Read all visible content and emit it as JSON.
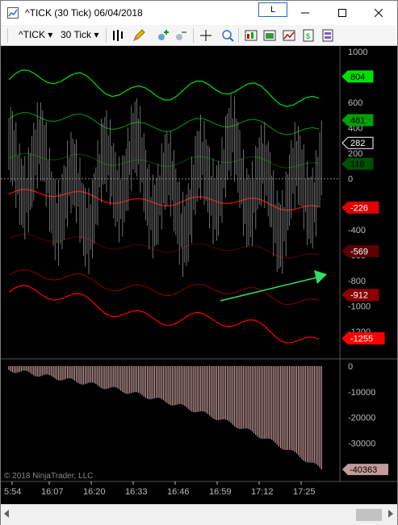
{
  "window": {
    "title": "^TICK (30 Tick)  06/04/2018",
    "link_button": "L"
  },
  "toolbar": {
    "instrument": "^TICK",
    "interval": "30 Tick"
  },
  "chart": {
    "copyright": "© 2018 NinjaTrader, LLC",
    "price_axis": [
      "1000",
      "800",
      "600",
      "400",
      "200",
      "0",
      "-200",
      "-400",
      "-600",
      "-800",
      "-1000",
      "-1200"
    ],
    "price_labels": [
      {
        "text": "804",
        "color": "#00e000",
        "text_color": "#000000"
      },
      {
        "text": "461",
        "color": "#00a000",
        "text_color": "#000000"
      },
      {
        "text": "282",
        "color": "#000000",
        "text_color": "#ffffff"
      },
      {
        "text": "118",
        "color": "#005000",
        "text_color": "#000000"
      },
      {
        "text": "-226",
        "color": "#e00000",
        "text_color": "#ffffff"
      },
      {
        "text": "-569",
        "color": "#5a0000",
        "text_color": "#ffffff"
      },
      {
        "text": "-912",
        "color": "#8b0000",
        "text_color": "#ffffff"
      },
      {
        "text": "-1255",
        "color": "#ff0000",
        "text_color": "#ffffff"
      }
    ],
    "lower_axis": [
      "0",
      "-10000",
      "-20000",
      "-30000",
      "-40000"
    ],
    "lower_label": {
      "text": "-40363",
      "color": "#c49a9a"
    },
    "time_axis": [
      "5:54",
      "16:07",
      "16:20",
      "16:33",
      "16:46",
      "16:59",
      "17:12",
      "17:25"
    ]
  },
  "chart_data": {
    "type": "line",
    "upper_panel": {
      "ylim": [
        -1300,
        1000
      ],
      "last_values": {
        "upper_band_3": 804,
        "upper_band_2": 461,
        "tick_close": 282,
        "upper_band_1": 118,
        "middle": -226,
        "lower_band_1": -569,
        "lower_band_2": -912,
        "lower_band_3": -1255
      }
    },
    "lower_panel": {
      "type": "bar",
      "ylim": [
        -45000,
        0
      ],
      "last_value": -40363
    }
  }
}
